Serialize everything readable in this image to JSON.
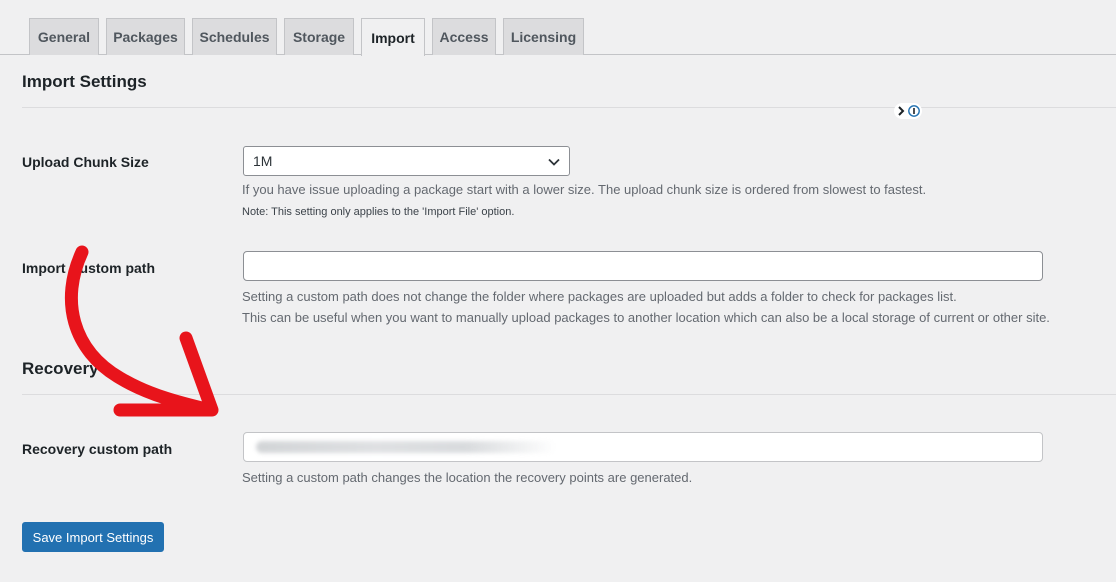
{
  "tabs": [
    {
      "label": "General"
    },
    {
      "label": "Packages"
    },
    {
      "label": "Schedules"
    },
    {
      "label": "Storage"
    },
    {
      "label": "Import"
    },
    {
      "label": "Access"
    },
    {
      "label": "Licensing"
    }
  ],
  "active_tab": "Import",
  "import_settings": {
    "heading": "Import Settings",
    "chunk_size": {
      "label": "Upload Chunk Size",
      "selected": "1M",
      "description": "If you have issue uploading a package start with a lower size. The upload chunk size is ordered from slowest to fastest.",
      "note": "Note: This setting only applies to the 'Import File' option."
    },
    "custom_path": {
      "label": "Import Custom path",
      "value": "",
      "description_line1": "Setting a custom path does not change the folder where packages are uploaded but adds a folder to check for packages list.",
      "description_line2": "This can be useful when you want to manually upload packages to another location which can also be a local storage of current or other site."
    }
  },
  "recovery": {
    "heading": "Recovery",
    "custom_path": {
      "label": "Recovery custom path",
      "description": "Setting a custom path changes the location the recovery points are generated."
    }
  },
  "save_button": "Save Import Settings",
  "colors": {
    "accent": "#2271b1",
    "annotation_arrow": "#e8141b",
    "background": "#f0f0f1"
  }
}
